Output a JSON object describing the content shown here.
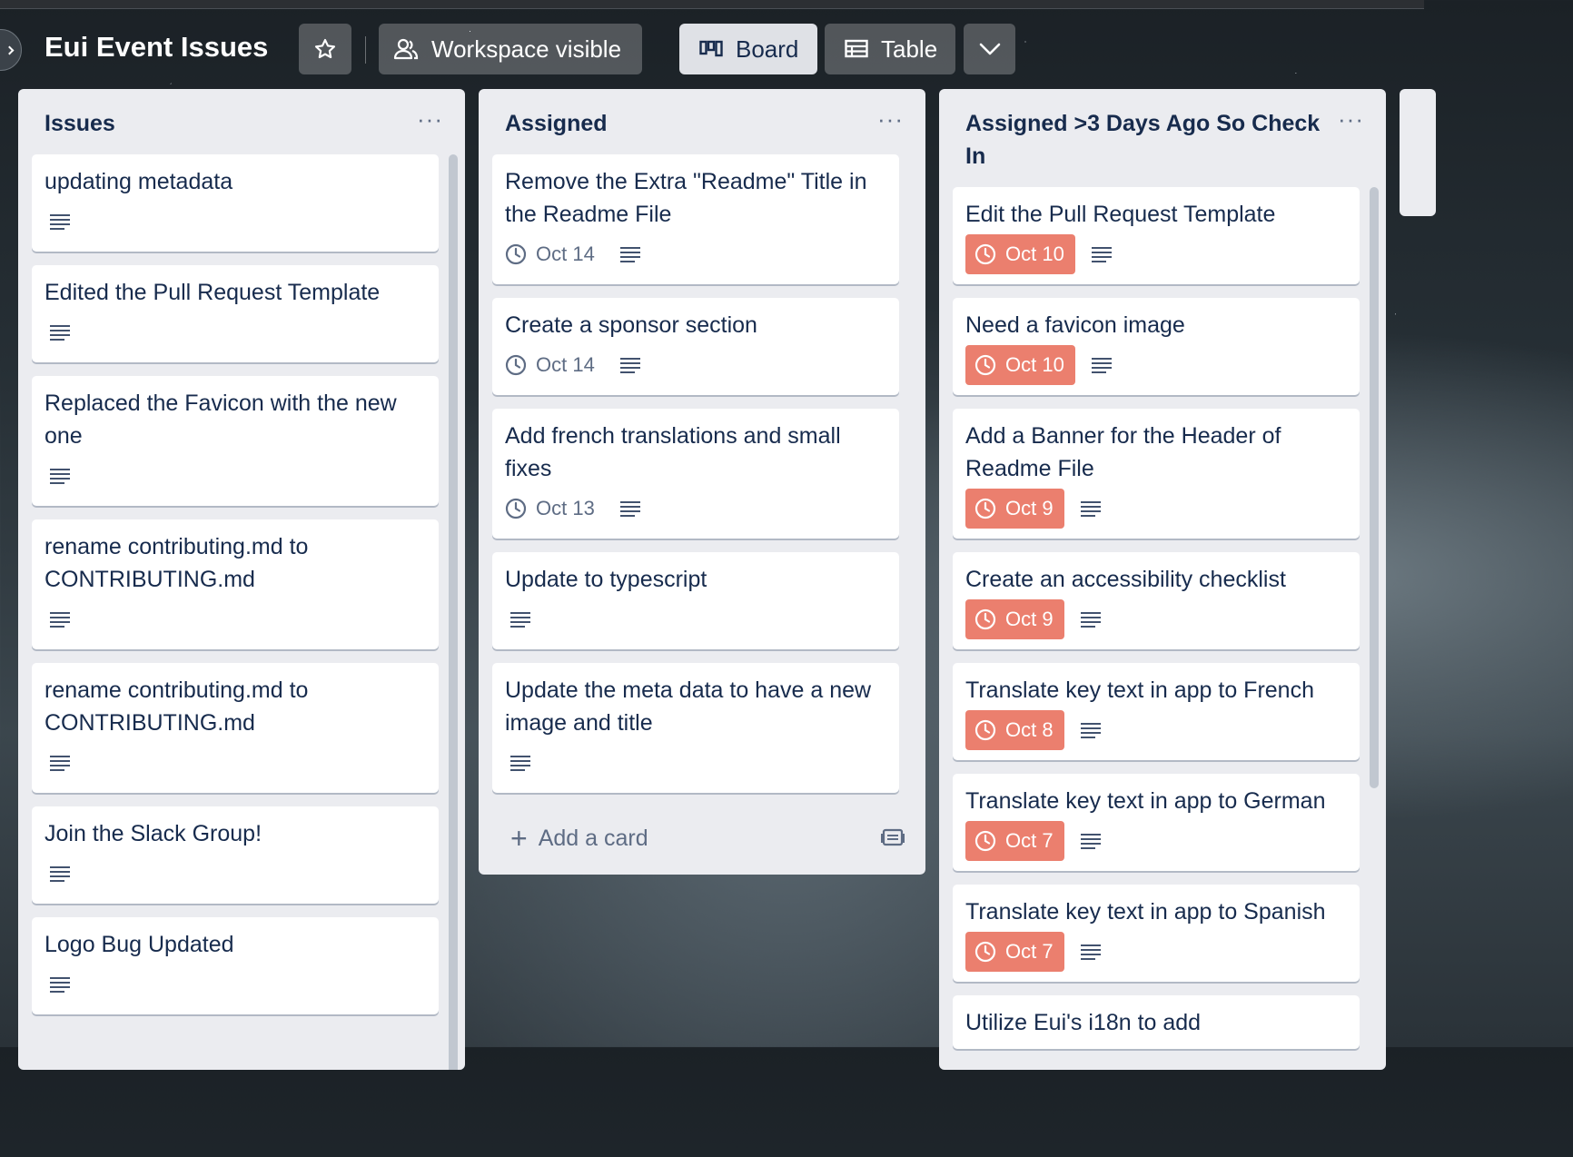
{
  "board": {
    "title": "Eui Event Issues",
    "visibility_label": "Workspace visible",
    "views": [
      {
        "label": "Board",
        "active": true
      },
      {
        "label": "Table",
        "active": false
      }
    ]
  },
  "colors": {
    "overdue": "#eb7f6e",
    "list_bg": "#ebecf0",
    "card_text": "#172b4d",
    "muted": "#5e6c84"
  },
  "lists": [
    {
      "title": "Issues",
      "cards": [
        {
          "title": "updating metadata",
          "due": ""
        },
        {
          "title": "Edited the Pull Request Template",
          "due": ""
        },
        {
          "title": "Replaced the Favicon with the new one",
          "due": ""
        },
        {
          "title": "rename contributing.md to CONTRIBUTING.md",
          "due": ""
        },
        {
          "title": "rename contributing.md to CONTRIBUTING.md",
          "due": ""
        },
        {
          "title": "Join the Slack Group!",
          "due": ""
        },
        {
          "title": "Logo Bug Updated",
          "due": ""
        }
      ]
    },
    {
      "title": "Assigned",
      "cards": [
        {
          "title": "Remove the Extra \"Readme\" Title in the Readme File",
          "due": "Oct 14"
        },
        {
          "title": "Create a sponsor section",
          "due": "Oct 14"
        },
        {
          "title": "Add french translations and small fixes",
          "due": "Oct 13"
        },
        {
          "title": "Update to typescript",
          "due": ""
        },
        {
          "title": "Update the meta data to have a new image and title",
          "due": ""
        }
      ],
      "add_card_label": "Add a card"
    },
    {
      "title": "Assigned >3 Days Ago So Check In",
      "cards": [
        {
          "title": "Edit the Pull Request Template",
          "due": "Oct 10"
        },
        {
          "title": "Need a favicon image",
          "due": "Oct 10"
        },
        {
          "title": "Add a Banner for the Header of Readme File",
          "due": "Oct 9"
        },
        {
          "title": "Create an accessibility checklist",
          "due": "Oct 9"
        },
        {
          "title": "Translate key text in app to French",
          "due": "Oct 8"
        },
        {
          "title": "Translate key text in app to German",
          "due": "Oct 7"
        },
        {
          "title": "Translate key text in app to Spanish",
          "due": "Oct 7"
        },
        {
          "title": "Utilize Eui's i18n to add",
          "due": ""
        }
      ]
    }
  ]
}
